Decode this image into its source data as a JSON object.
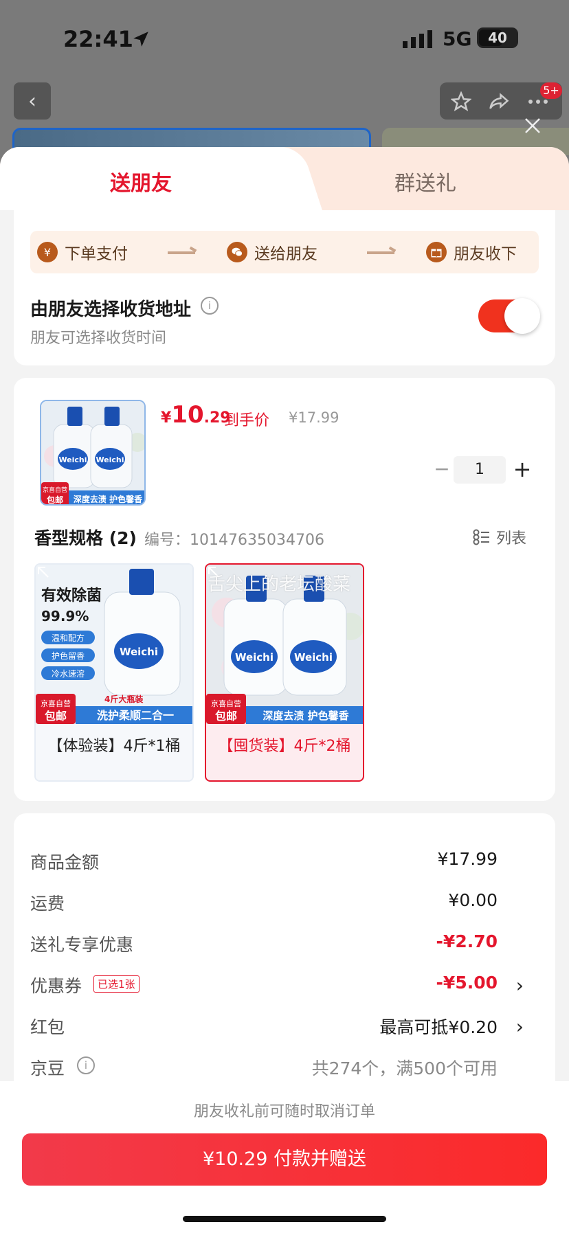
{
  "status_bar": {
    "time": "22:41",
    "network": "5G",
    "battery": "40"
  },
  "nav": {
    "badge": "5+"
  },
  "tabs": {
    "send_friend": "送朋友",
    "group_gift": "群送礼"
  },
  "steps": [
    {
      "icon": "yen-icon",
      "label": "下单支付"
    },
    {
      "icon": "wechat-icon",
      "label": "送给朋友"
    },
    {
      "icon": "gift-icon",
      "label": "朋友收下"
    }
  ],
  "address": {
    "title": "由朋友选择收货地址",
    "subtitle": "朋友可选择收货时间",
    "toggle_on": true
  },
  "product": {
    "price_yen": "¥",
    "price_int": "10",
    "price_dec": ".29",
    "price_tag": "到手价",
    "original_price": "¥17.99",
    "quantity": "1",
    "qty_minus": "−",
    "qty_plus": "+"
  },
  "spec": {
    "title": "香型规格 (2)",
    "code": "编号：10147635034706",
    "list_view": "列表",
    "watermark": "舌尖上的老坛酸菜",
    "items": [
      {
        "label": "【体验装】4斤*1桶",
        "selected": false
      },
      {
        "label": "【囤货装】4斤*2桶",
        "selected": true
      }
    ]
  },
  "product_images": {
    "badge_top": "京喜自营",
    "badge_bottom": "包邮",
    "brand": "Weichi",
    "thumb_banner": "深度去渍 护色馨香",
    "s1_headline": "有效除菌",
    "s1_percent": "99.9%",
    "s1_features": [
      "温和配方",
      "护色留香",
      "冷水速溶"
    ],
    "s1_size": "4斤大瓶装",
    "s1_banner": "洗护柔顺二合一",
    "s2_banner": "深度去渍 护色馨香"
  },
  "summary": {
    "rows": [
      {
        "label": "商品金额",
        "value": "¥17.99"
      },
      {
        "label": "运费",
        "value": "¥0.00"
      },
      {
        "label": "送礼专享优惠",
        "value": "-¥2.70"
      },
      {
        "label": "优惠券",
        "tag": "已选1张",
        "value": "-¥5.00"
      },
      {
        "label": "红包",
        "value": "最高可抵¥0.20"
      },
      {
        "label": "京豆",
        "value": "共274个，满500个可用"
      }
    ]
  },
  "bottom": {
    "note": "朋友收礼前可随时取消订单",
    "pay_button": "¥10.29 付款并赠送"
  },
  "colors": {
    "accent": "#e4162d",
    "toggle": "#f0321e",
    "step_icon": "#b85a1c"
  }
}
